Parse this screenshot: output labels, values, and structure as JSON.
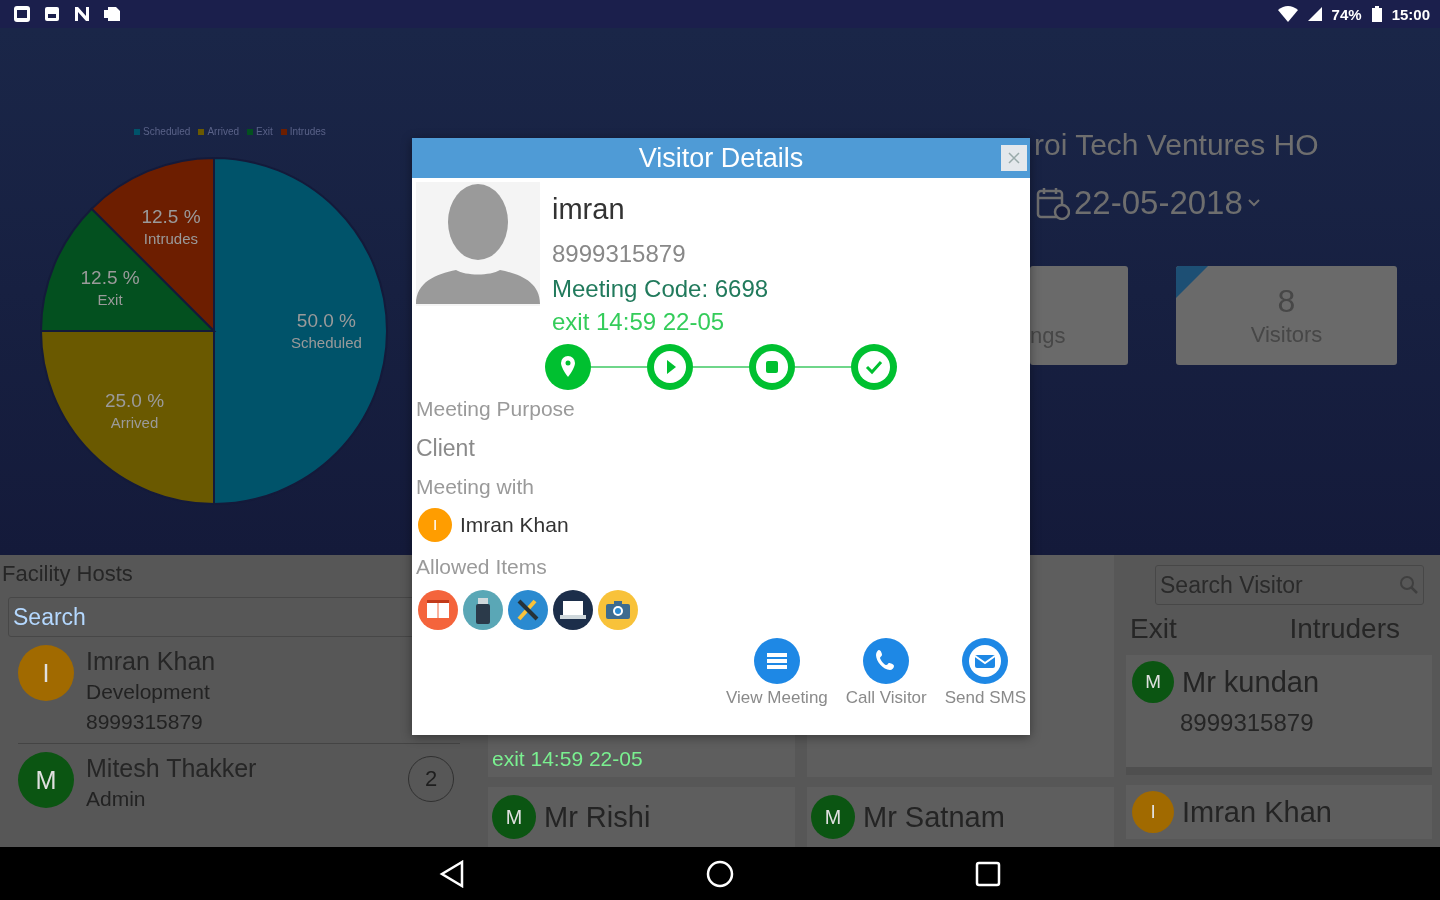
{
  "status_bar": {
    "notifications": [
      {
        "kind": "window"
      },
      {
        "kind": "image"
      },
      {
        "kind": "letter"
      },
      {
        "kind": "tag"
      }
    ],
    "battery": "74%",
    "time": "15:00"
  },
  "chart": {
    "chart_data": {
      "type": "pie",
      "categories": [
        "Scheduled",
        "Arrived",
        "Exit",
        "Intrudes"
      ],
      "values": [
        50,
        25,
        12.5,
        12.5
      ],
      "colors": [
        "#00536a",
        "#6a5900",
        "#03501f",
        "#6d1e00"
      ],
      "data_labels": true,
      "value_labels": [
        "50.0 %",
        "25.0 %",
        "12.5 %",
        "12.5 %"
      ]
    }
  },
  "header": {
    "title": "roi Tech Ventures HO",
    "date": "22-05-2018"
  },
  "stat_cards": [
    {
      "label": "ngs",
      "corner_flag": false
    },
    {
      "value": "8",
      "label": "Visitors",
      "corner_flag": true
    }
  ],
  "hosts": {
    "title": "Facility Hosts",
    "search_placeholder": "Search",
    "items": [
      {
        "initial": "I",
        "color": "#a16a00",
        "name": "Imran Khan",
        "role": "Development",
        "phone": "8999315879"
      },
      {
        "initial": "M",
        "color": "#0b5512",
        "name": "Mitesh Thakker",
        "role": "Admin",
        "count": "2"
      }
    ]
  },
  "meetings": {
    "columns": [
      {
        "cards": [
          {
            "kind": "status",
            "status": "exit 14:59 22-05"
          },
          {
            "kind": "visitor",
            "initial": "M",
            "color": "#0b5512",
            "name": "Mr Rishi"
          }
        ]
      },
      {
        "cards": [
          {
            "kind": "blank"
          },
          {
            "kind": "visitor",
            "initial": "M",
            "color": "#0b5512",
            "name": "Mr Satnam"
          }
        ]
      }
    ]
  },
  "visitors_panel": {
    "search_placeholder": "Search Visitor",
    "headers": [
      "Exit",
      "Intruders"
    ],
    "cards": [
      {
        "initial": "M",
        "color": "#0b5512",
        "name": "Mr kundan",
        "phone": "8999315879"
      },
      {
        "initial": "I",
        "color": "#a16a00",
        "name": "Imran Khan"
      }
    ]
  },
  "dialog": {
    "title": "Visitor Details",
    "name": "imran",
    "phone": "8999315879",
    "meeting_code": "Meeting Code: 6698",
    "status": "exit 14:59 22-05",
    "steps": [
      {
        "kind": "location"
      },
      {
        "kind": "play"
      },
      {
        "kind": "stop"
      },
      {
        "kind": "check"
      }
    ],
    "purpose_label": "Meeting Purpose",
    "purpose": "Client",
    "meeting_with_label": "Meeting with",
    "host": {
      "initial": "I",
      "color": "#ff9d00",
      "name": "Imran Khan"
    },
    "allowed_items_label": "Allowed Items",
    "allowed_items": [
      {
        "kind": "book"
      },
      {
        "kind": "usb"
      },
      {
        "kind": "tools"
      },
      {
        "kind": "laptop"
      },
      {
        "kind": "camera"
      }
    ],
    "actions": [
      {
        "kind": "list",
        "label": "View Meeting"
      },
      {
        "kind": "phone",
        "label": "Call Visitor"
      },
      {
        "kind": "mail",
        "label": "Send SMS"
      }
    ]
  }
}
